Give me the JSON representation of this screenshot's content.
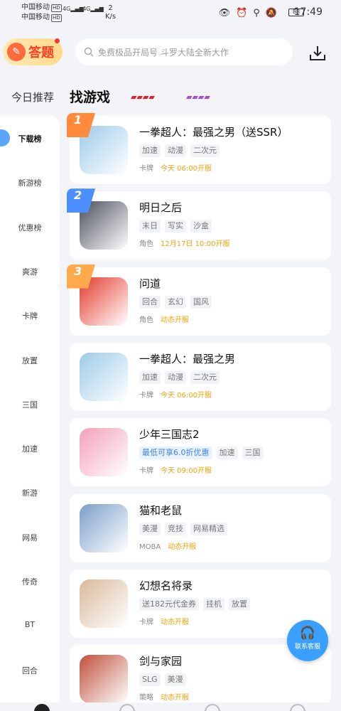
{
  "status": {
    "carrier1": "中国移动",
    "carrier2": "中国移动",
    "hd": "HD",
    "net": "4G",
    "speed_value": "2",
    "speed_unit": "K/s",
    "battery": "83",
    "time": "17:49"
  },
  "header": {
    "quiz_label": "答题",
    "search_placeholder": "免费极品开局号 斗罗大陆全新大作"
  },
  "tabs": {
    "today": "今日推荐",
    "find": "找游戏"
  },
  "sidebar": [
    "下载榜",
    "新游榜",
    "优惠榜",
    "爽游",
    "卡牌",
    "放置",
    "三国",
    "加速",
    "新游",
    "网易",
    "传奇",
    "BT",
    "回合"
  ],
  "games": [
    {
      "rank": "1",
      "name": "一拳超人：最强之男（送SSR）",
      "tags": [
        "加速",
        "动漫",
        "二次元"
      ],
      "hl": [],
      "category": "卡牌",
      "time": "今天 06:00开服",
      "icon_bg": "#9ccbe8",
      "rank_color": "#ff8a3c"
    },
    {
      "rank": "2",
      "name": "明日之后",
      "tags": [
        "末日",
        "写实",
        "沙盒"
      ],
      "hl": [],
      "category": "角色",
      "time": "12月17日 10:00开服",
      "icon_bg": "#4a4f5c",
      "rank_color": "#4c8dff"
    },
    {
      "rank": "3",
      "name": "问道",
      "tags": [
        "回合",
        "玄幻",
        "国风"
      ],
      "hl": [],
      "category": "角色",
      "time": "动态开服",
      "icon_bg": "#e33b2e",
      "rank_color": "#ffa94d"
    },
    {
      "rank": "",
      "name": "一拳超人：最强之男",
      "tags": [
        "加速",
        "动漫",
        "二次元"
      ],
      "hl": [],
      "category": "卡牌",
      "time": "今天 06:00开服",
      "icon_bg": "#9ccbe8",
      "rank_color": ""
    },
    {
      "rank": "",
      "name": "少年三国志2",
      "tags": [
        "最低可享6.0折优惠",
        "加速",
        "三国"
      ],
      "hl": [
        0
      ],
      "category": "卡牌",
      "time": "今天 09:00开服",
      "icon_bg": "#f4a0b8",
      "rank_color": ""
    },
    {
      "rank": "",
      "name": "猫和老鼠",
      "tags": [
        "美漫",
        "竞技",
        "网易精选"
      ],
      "hl": [],
      "category": "MOBA",
      "time": "动态开服",
      "icon_bg": "#7b9ec9",
      "rank_color": ""
    },
    {
      "rank": "",
      "name": "幻想名将录",
      "tags": [
        "送182元代金券",
        "挂机",
        "放置"
      ],
      "hl": [],
      "category": "卡牌",
      "time": "动态开服",
      "icon_bg": "#d9b99a",
      "rank_color": ""
    },
    {
      "rank": "",
      "name": "剑与家园",
      "tags": [
        "SLG",
        "美漫"
      ],
      "hl": [],
      "category": "策略",
      "time": "动态开服",
      "icon_bg": "#c0503a",
      "rank_color": ""
    }
  ],
  "service": {
    "label": "联系客服"
  }
}
